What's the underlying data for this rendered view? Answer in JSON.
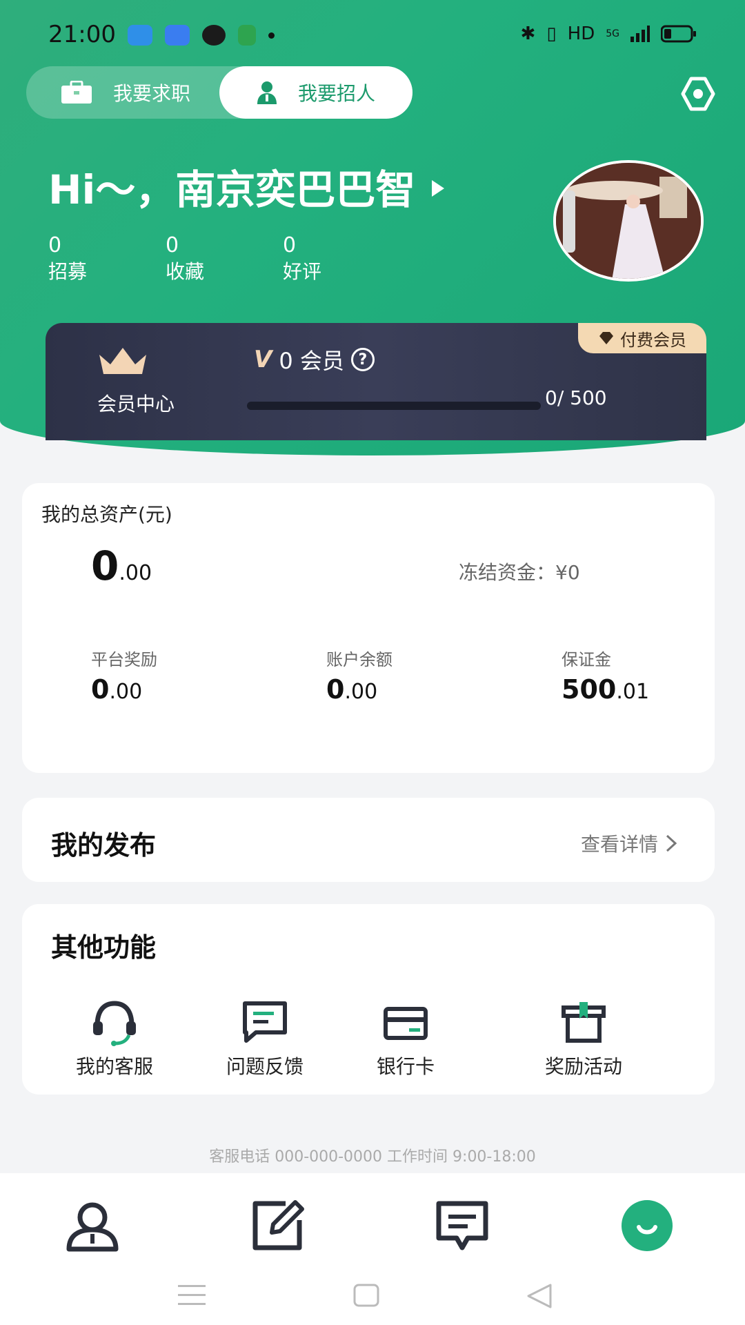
{
  "status_bar": {
    "time": "21:00",
    "network": "HD",
    "signal": "5G"
  },
  "mode_switch": {
    "job_label": "我要求职",
    "hire_label": "我要招人"
  },
  "greeting": {
    "text": "Hi～，南京奕巴巴智"
  },
  "stats": [
    {
      "value": "0",
      "label": "招募"
    },
    {
      "value": "0",
      "label": "收藏"
    },
    {
      "value": "0",
      "label": "好评"
    }
  ],
  "vip": {
    "center_label": "会员中心",
    "level_text": "0 会员",
    "progress_text": "0/ 500",
    "progress_fraction": 0,
    "paid_badge": "付费会员",
    "accent_color": "#f4d9b3"
  },
  "assets": {
    "title": "我的总资产(元)",
    "total_int": "0",
    "total_dec": ".00",
    "frozen": "冻结资金：¥0",
    "items": [
      {
        "label": "平台奖励",
        "int": "0",
        "dec": ".00"
      },
      {
        "label": "账户余额",
        "int": "0",
        "dec": ".00"
      },
      {
        "label": "保证金",
        "int": "500",
        "dec": ".01"
      }
    ]
  },
  "publish": {
    "title": "我的发布",
    "link": "查看详情"
  },
  "other": {
    "title": "其他功能",
    "items": [
      {
        "label": "我的客服",
        "icon": "headset-icon"
      },
      {
        "label": "问题反馈",
        "icon": "feedback-icon"
      },
      {
        "label": "银行卡",
        "icon": "bank-card-icon"
      },
      {
        "label": "奖励活动",
        "icon": "gift-icon"
      }
    ]
  },
  "footer": {
    "service": "客服电话  000-000-0000   工作时间  9:00-18:00"
  },
  "bottom_nav": [
    "person-icon",
    "edit-icon",
    "message-icon",
    "smile-icon"
  ],
  "colors": {
    "brand": "#23b07e",
    "card_dark": "#2d3147"
  }
}
